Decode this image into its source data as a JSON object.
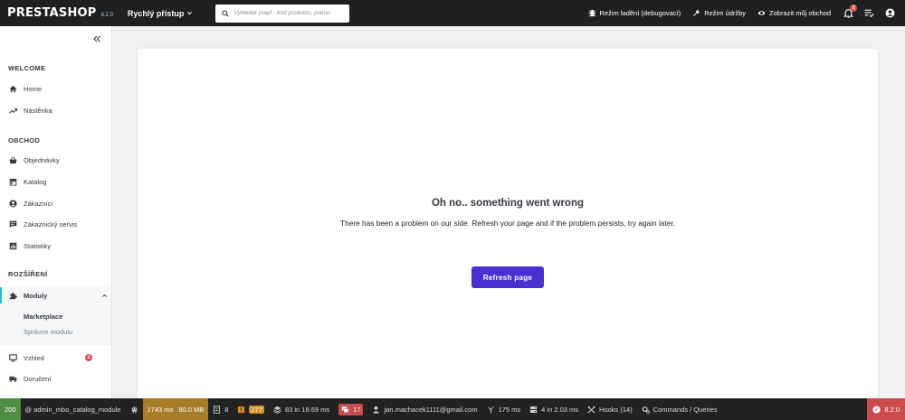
{
  "header": {
    "logo_text": "PRESTASHOP",
    "version": "8.2.0",
    "quick_access_label": "Rychlý přístup",
    "search_placeholder": "Vyhledat (např.: kód produktu, jméno",
    "debug_mode_label": "Režim ladění (debugovací)",
    "maintenance_label": "Režim údržby",
    "view_shop_label": "Zobrazit můj obchod",
    "notifications_count": "2"
  },
  "sidebar": {
    "section_welcome": "WELCOME",
    "home": "Home",
    "dashboard": "Nástěnka",
    "section_shop": "OBCHOD",
    "orders": "Objednávky",
    "catalog": "Katalog",
    "customers": "Zákazníci",
    "customer_service": "Zákaznický servis",
    "stats": "Statistiky",
    "section_extensions": "ROZŠÍŘENÍ",
    "modules": "Moduly",
    "marketplace": "Marketplace",
    "module_manager": "Správce modulu",
    "appearance": "Vzhled",
    "appearance_badge": "1",
    "shipping": "Doručení"
  },
  "main": {
    "error_title": "Oh no.. something went wrong",
    "error_text": "There has been a problem on our side. Refresh your page and if the problem persists, try again later.",
    "refresh_button": "Refresh page"
  },
  "debugbar": {
    "status": "200",
    "route": "@ admin_mbo_catalog_module",
    "time": "1743 ms",
    "memory": "90.0 MB",
    "forms_count": "8",
    "translations_count": "277",
    "cache": "83 in 18.69 ms",
    "logs_count": "17",
    "user": "jan.machacek1111@gmail.com",
    "render_time": "175 ms",
    "db_queries": "4 in 2.03 ms",
    "hooks": "Hooks (14)",
    "commands": "Commands / Queries",
    "version": "8.2.0"
  },
  "colors": {
    "header_bg": "#1e2022",
    "accent": "#25b9d7",
    "primary_button": "#4c2fd0",
    "badge": "#e84e4e"
  }
}
